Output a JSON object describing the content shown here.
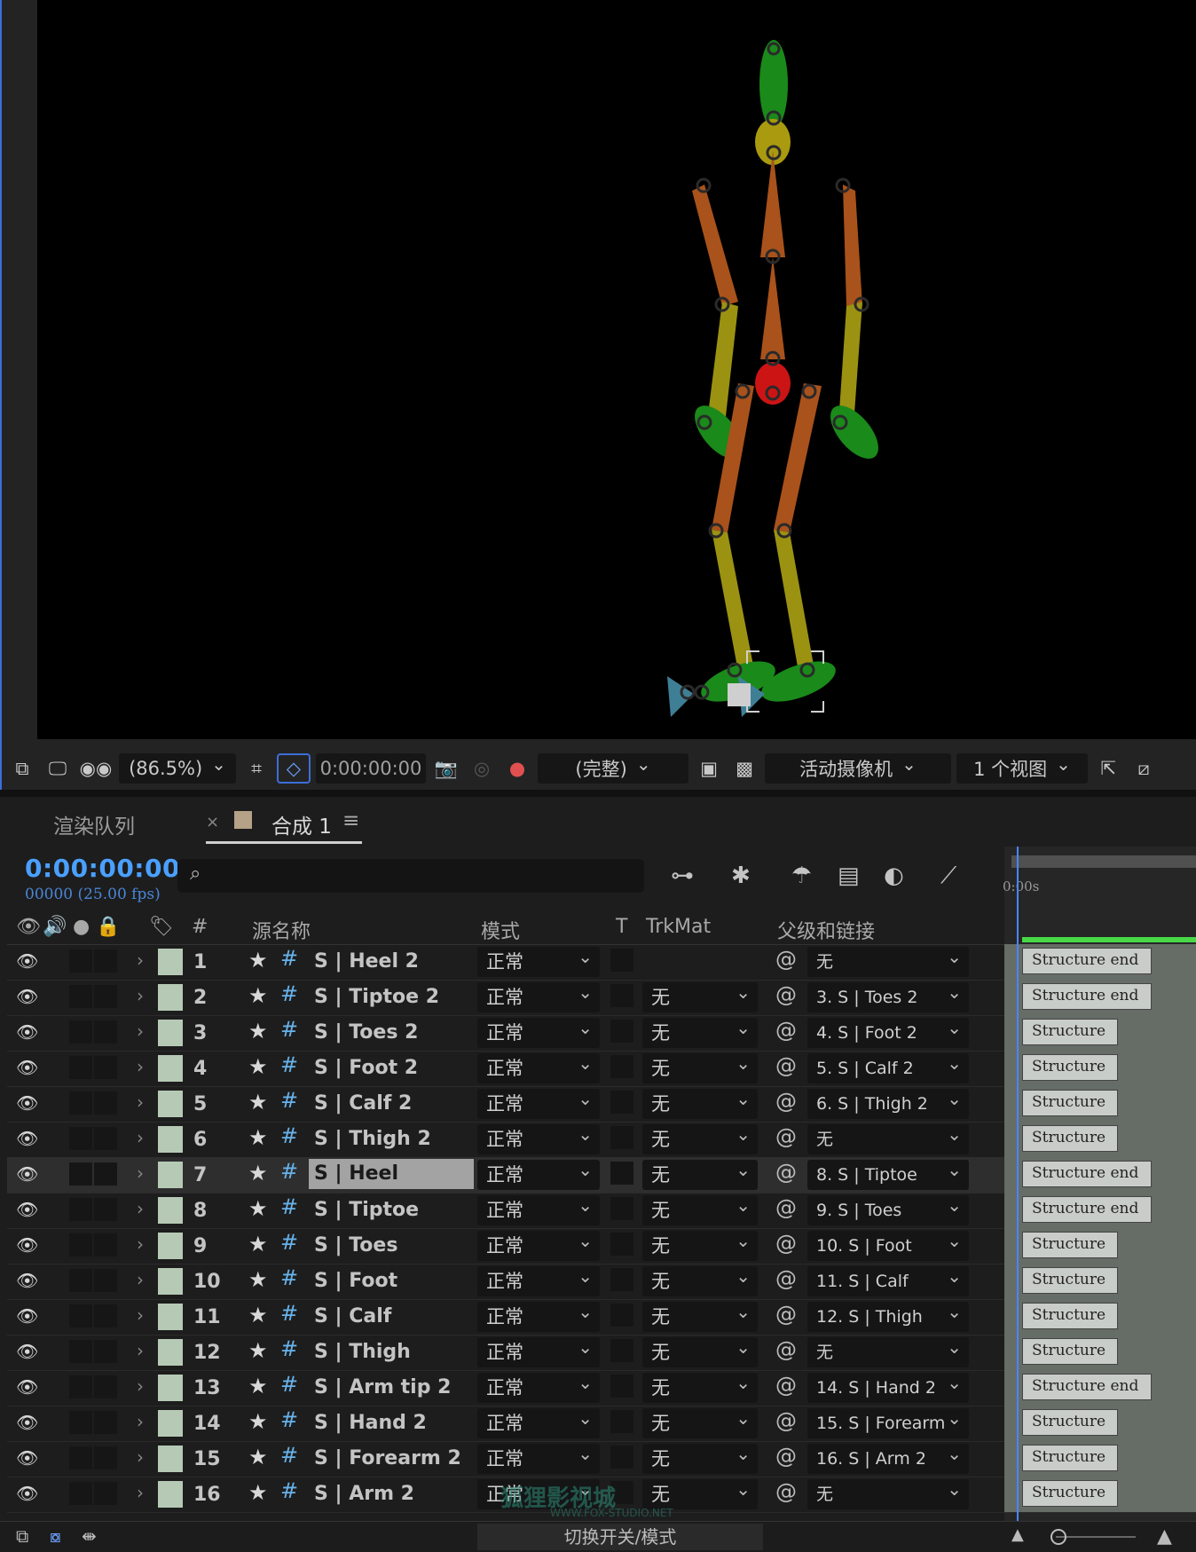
{
  "viewer": {
    "zoom": "(86.5%)",
    "timecode": "0:00:00:00",
    "resolution": "(完整)",
    "camera": "活动摄像机",
    "views": "1 个视图"
  },
  "tabs": {
    "render_queue": "渲染队列",
    "close": "×",
    "comp": "合成 1",
    "menu": "≡"
  },
  "timeline": {
    "timecode": "0:00:00:00",
    "fps": "00000 (25.00 fps)",
    "ruler_zero": "0:00s"
  },
  "columns": {
    "num": "#",
    "source": "源名称",
    "mode": "模式",
    "t": "T",
    "trkmat": "TrkMat",
    "parent": "父级和链接"
  },
  "layers": [
    {
      "num": "1",
      "name": "S | Heel 2",
      "mode": "正常",
      "trkmat": "",
      "parent": "无",
      "bar": "Structure end"
    },
    {
      "num": "2",
      "name": "S | Tiptoe 2",
      "mode": "正常",
      "trkmat": "无",
      "parent": "3. S | Toes 2",
      "bar": "Structure end"
    },
    {
      "num": "3",
      "name": "S | Toes 2",
      "mode": "正常",
      "trkmat": "无",
      "parent": "4. S | Foot 2",
      "bar": "Structure"
    },
    {
      "num": "4",
      "name": "S | Foot 2",
      "mode": "正常",
      "trkmat": "无",
      "parent": "5. S | Calf 2",
      "bar": "Structure"
    },
    {
      "num": "5",
      "name": "S | Calf 2",
      "mode": "正常",
      "trkmat": "无",
      "parent": "6. S | Thigh 2",
      "bar": "Structure"
    },
    {
      "num": "6",
      "name": "S | Thigh 2",
      "mode": "正常",
      "trkmat": "无",
      "parent": "无",
      "bar": "Structure"
    },
    {
      "num": "7",
      "name": "S | Heel",
      "mode": "正常",
      "trkmat": "无",
      "parent": "8. S | Tiptoe",
      "bar": "Structure end",
      "selected": true
    },
    {
      "num": "8",
      "name": "S | Tiptoe",
      "mode": "正常",
      "trkmat": "无",
      "parent": "9. S | Toes",
      "bar": "Structure end"
    },
    {
      "num": "9",
      "name": "S | Toes",
      "mode": "正常",
      "trkmat": "无",
      "parent": "10. S | Foot",
      "bar": "Structure"
    },
    {
      "num": "10",
      "name": "S | Foot",
      "mode": "正常",
      "trkmat": "无",
      "parent": "11. S | Calf",
      "bar": "Structure"
    },
    {
      "num": "11",
      "name": "S | Calf",
      "mode": "正常",
      "trkmat": "无",
      "parent": "12. S | Thigh",
      "bar": "Structure"
    },
    {
      "num": "12",
      "name": "S | Thigh",
      "mode": "正常",
      "trkmat": "无",
      "parent": "无",
      "bar": "Structure"
    },
    {
      "num": "13",
      "name": "S | Arm tip 2",
      "mode": "正常",
      "trkmat": "无",
      "parent": "14. S | Hand 2",
      "bar": "Structure end"
    },
    {
      "num": "14",
      "name": "S | Hand 2",
      "mode": "正常",
      "trkmat": "无",
      "parent": "15. S | Forearm",
      "bar": "Structure"
    },
    {
      "num": "15",
      "name": "S | Forearm 2",
      "mode": "正常",
      "trkmat": "无",
      "parent": "16. S | Arm 2",
      "bar": "Structure"
    },
    {
      "num": "16",
      "name": "S | Arm 2",
      "mode": "正常",
      "trkmat": "无",
      "parent": "无",
      "bar": "Structure"
    }
  ],
  "bottom": {
    "switch_modes": "切换开关/模式"
  },
  "watermark": {
    "main": "狐狸影视城",
    "url": "WWW.FOX-STUDIO.NET"
  },
  "colors": {
    "accent": "#4aa0ff",
    "label": "#b6c9b5",
    "bar": "#666c66",
    "selection": "#a3a3a3"
  }
}
